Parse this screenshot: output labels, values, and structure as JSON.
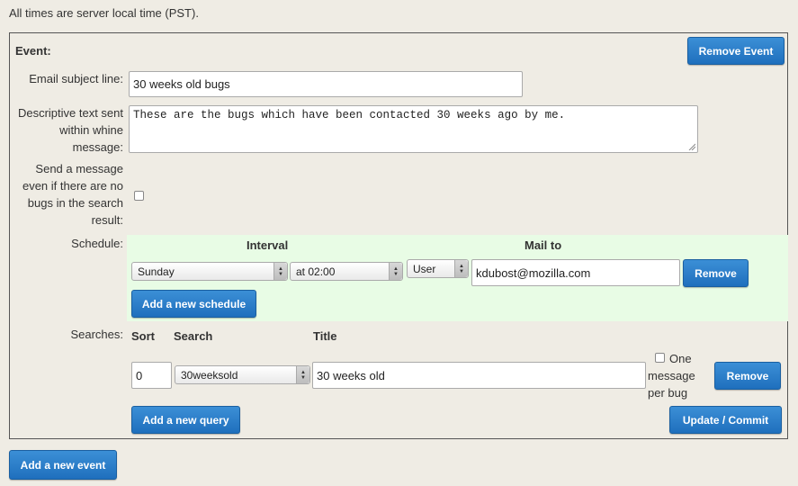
{
  "notice": "All times are server local time (PST).",
  "event": {
    "heading": "Event:",
    "remove_event_label": "Remove Event",
    "subject_label": "Email subject line:",
    "subject_value": "30 weeks old bugs",
    "desc_label": [
      "Descriptive text sent",
      "within whine",
      "message:"
    ],
    "desc_value": "These are the bugs which have been contacted 30 weeks ago by me.",
    "send_empty_label": [
      "Send a message",
      "even if there are no",
      "bugs in the search",
      "result:"
    ],
    "send_empty_checked": false
  },
  "schedule": {
    "label": "Schedule:",
    "interval_header": "Interval",
    "mailto_header": "Mail to",
    "day_value": "Sunday",
    "time_value": "at 02:00",
    "mailto_type_value": "User",
    "mailto_value": "kdubost@mozilla.com",
    "remove_label": "Remove",
    "add_label": "Add a new schedule"
  },
  "searches": {
    "label": "Searches:",
    "sort_header": "Sort",
    "search_header": "Search",
    "title_header": "Title",
    "sort_value": "0",
    "search_value": "30weeksold",
    "title_value": "30 weeks old",
    "one_message_label": [
      "One",
      "message",
      "per bug"
    ],
    "one_message_checked": false,
    "remove_label": "Remove",
    "add_label": "Add a new query",
    "update_label": "Update / Commit"
  },
  "add_event_label": "Add a new event",
  "colors": {
    "page_bg": "#efece4",
    "button_blue": "#2a7fcf",
    "schedule_bg": "#e8fce5"
  }
}
